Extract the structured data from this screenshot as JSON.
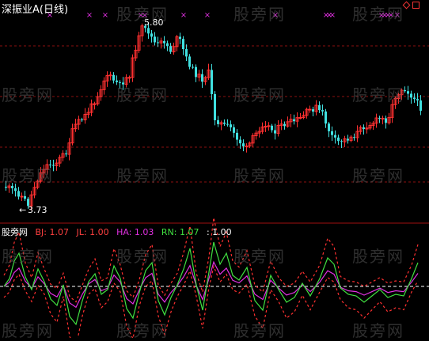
{
  "header": {
    "title": "深振业A(日线)"
  },
  "price_panel": {
    "high_label": "5.80",
    "low_label": "3.73",
    "marker_glyph": "×",
    "arrow_glyph": "←"
  },
  "indicator_panel": {
    "name": "股旁网",
    "values": [
      {
        "text": "BJ: 1.07",
        "color": "#ff4040"
      },
      {
        "text": "JL: 1.00",
        "color": "#ff4040"
      },
      {
        "text": "HA: 1.03",
        "color": "#e030e0"
      },
      {
        "text": "RN: 1.07",
        "color": "#40e040"
      },
      {
        "text": ": 1.00",
        "color": "#ffffff"
      }
    ]
  },
  "watermark": "股旁网",
  "colors": {
    "up": "#ff3030",
    "down": "#40e0e0",
    "grid": "#8b1010",
    "ha_line": "#e030e0",
    "rn_line": "#40e040",
    "band_line": "#ff3030",
    "marker": "#e030e0"
  },
  "chart_data": {
    "type": "candlestick",
    "price": {
      "high": 5.8,
      "low": 3.73
    },
    "indicator_last": {
      "BJ": 1.07,
      "JL": 1.0,
      "HA": 1.03,
      "RN": 1.07,
      "base": 1.0
    }
  }
}
